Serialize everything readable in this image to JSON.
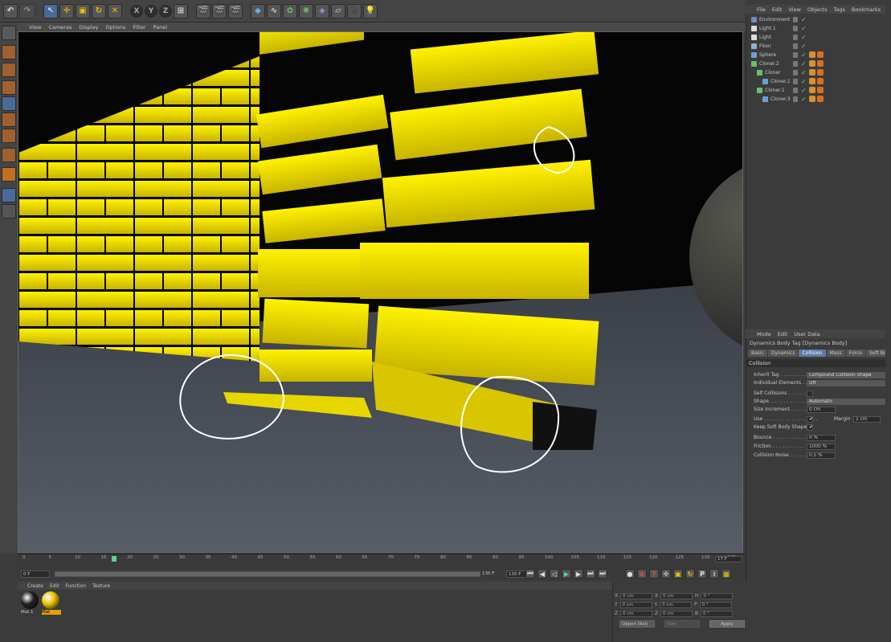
{
  "menus": {
    "viewport": [
      "View",
      "Cameras",
      "Display",
      "Options",
      "Filter",
      "Panel"
    ],
    "object_manager": [
      "File",
      "Edit",
      "View",
      "Objects",
      "Tags",
      "Bookmarks"
    ],
    "attributes": [
      "Mode",
      "Edit",
      "User Data"
    ],
    "material": [
      "Create",
      "Edit",
      "Function",
      "Texture"
    ]
  },
  "toolbar": {
    "x": "X",
    "y": "Y",
    "z": "Z"
  },
  "objects": [
    {
      "name": "Environment",
      "indent": 0,
      "icon_color": "#6a8fbf"
    },
    {
      "name": "Light.1",
      "indent": 0,
      "icon_color": "#dddddd"
    },
    {
      "name": "Light",
      "indent": 0,
      "icon_color": "#dddddd"
    },
    {
      "name": "Floor",
      "indent": 0,
      "icon_color": "#8fb0d8"
    },
    {
      "name": "Sphere",
      "indent": 0,
      "icon_color": "#6aa0d8"
    },
    {
      "name": "Cloner.2",
      "indent": 0,
      "icon_color": "#6ac06a"
    },
    {
      "name": "Cloner",
      "indent": 1,
      "icon_color": "#6ac06a"
    },
    {
      "name": "Cloner.1",
      "indent": 2,
      "icon_color": "#6aa0d8"
    },
    {
      "name": "Cloner.1",
      "indent": 1,
      "icon_color": "#6ac06a"
    },
    {
      "name": "Cloner.3",
      "indent": 2,
      "icon_color": "#6aa0d8"
    }
  ],
  "attributes": {
    "title": "Dynamics Body Tag [Dynamics Body]",
    "tabs": [
      "Basic",
      "Dynamics",
      "Collision",
      "Mass",
      "Force",
      "Soft Bo"
    ],
    "active_tab": "Collision",
    "section": "Collision",
    "props": [
      {
        "label": "Inherit Tag . . . . . . . . . .",
        "value": "Compound Collision Shape",
        "type": "dropdown"
      },
      {
        "label": "Individual Elements . . .",
        "value": "Off",
        "type": "dropdown"
      },
      {
        "label": "Self Collisions . . . . . . .",
        "value": "",
        "type": "check"
      },
      {
        "label": "Shape. . . . . . . . . . . . . . . .",
        "value": "Automatic",
        "type": "dropdown"
      },
      {
        "label": "Size Increment. . . . . . .",
        "value": "0 cm",
        "type": "number"
      },
      {
        "label": "Use . . . . . . . . . . . . . . . . . .",
        "value": "✔",
        "type": "check"
      },
      {
        "label": "Keep Soft Body Shape",
        "value": "✔",
        "type": "check"
      },
      {
        "label": "Bounce . . . . . . . . . . . . . .",
        "value": "0 %",
        "type": "number"
      },
      {
        "label": "Friction . . . . . . . . . . . . .",
        "value": "1000 %",
        "type": "number"
      },
      {
        "label": "Collision Noise . . . . . . .",
        "value": "0.5 %",
        "type": "number"
      }
    ],
    "margin_label": "Margin",
    "margin_value": "1 cm"
  },
  "timeline": {
    "ticks": [
      "0",
      "5",
      "10",
      "15",
      "20",
      "25",
      "30",
      "35",
      "40",
      "45",
      "50",
      "55",
      "60",
      "65",
      "70",
      "75",
      "80",
      "85",
      "90",
      "95",
      "100",
      "105",
      "110",
      "115",
      "120",
      "125",
      "130",
      "135"
    ],
    "current_frame": "17",
    "current_frame_field": "17 F",
    "start_field": "0 F",
    "end_field": "130 F",
    "end_field2": "130 F"
  },
  "materials": [
    {
      "name": "Mat.1",
      "color": "#222222"
    },
    {
      "name": "Mat",
      "color": "#e8c400"
    }
  ],
  "coords": {
    "rows": [
      {
        "a": "X",
        "av": "0 cm",
        "b": "X",
        "bv": "0 cm",
        "c": "H",
        "cv": "0 °"
      },
      {
        "a": "Y",
        "av": "0 cm",
        "b": "Y",
        "bv": "0 cm",
        "c": "P",
        "cv": "0 °"
      },
      {
        "a": "Z",
        "av": "0 cm",
        "b": "Z",
        "bv": "0 cm",
        "c": "B",
        "cv": "0 °"
      }
    ],
    "mode": "Object (Rel)",
    "size_mode": "Size",
    "apply": "Apply"
  },
  "colors": {
    "accent": "#5c7ca8",
    "brick": "#f2e000",
    "playhead": "#55d88a"
  }
}
